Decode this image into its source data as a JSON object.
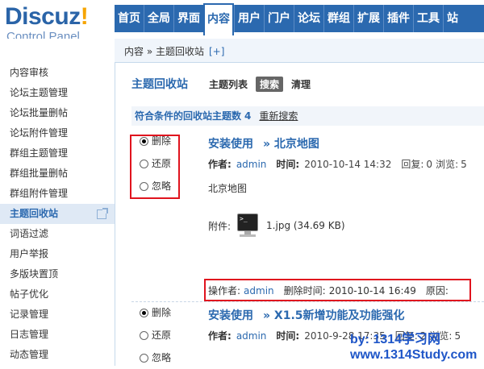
{
  "logo": {
    "word": "Discuz",
    "bang": "!",
    "subtitle": "Control Panel"
  },
  "nav": [
    "首页",
    "全局",
    "界面",
    "内容",
    "用户",
    "门户",
    "论坛",
    "群组",
    "扩展",
    "插件",
    "工具",
    "站"
  ],
  "nav_active": "内容",
  "breadcrumb": {
    "path": "内容 » 主题回收站",
    "plus": "[+]"
  },
  "sidebar": {
    "items": [
      "内容审核",
      "论坛主题管理",
      "论坛批量删帖",
      "论坛附件管理",
      "群组主题管理",
      "群组批量删帖",
      "群组附件管理",
      "主题回收站",
      "词语过滤",
      "用户举报",
      "多版块置顶",
      "帖子优化",
      "记录管理",
      "日志管理",
      "动态管理"
    ],
    "active": "主题回收站"
  },
  "main": {
    "title": "主题回收站",
    "tabs": {
      "list": "主题列表",
      "search": "搜索",
      "clear": "清理"
    },
    "count_label": "符合条件的回收站主题数",
    "count": "4",
    "reset": "重新搜索",
    "radio_labels": {
      "delete": "删除",
      "restore": "还原",
      "ignore": "忽略"
    },
    "posts": [
      {
        "title": "安装使用",
        "arrow_title": "» 北京地图",
        "author_label": "作者:",
        "author": "admin",
        "time_label": "时间:",
        "time": "2010-10-14 14:32",
        "reply_label": "回复:",
        "reply": "0",
        "view_label": "浏览:",
        "view": "5",
        "body": "北京地图",
        "attach_label": "附件:",
        "attach_file": "1.jpg (34.69 KB)",
        "op_label": "操作者:",
        "op_user": "admin",
        "del_time_label": "删除时间:",
        "del_time": "2010-10-14 16:49",
        "reason_label": "原因:"
      },
      {
        "title": "安装使用",
        "arrow_title": "» X1.5新增功能及功能强化",
        "author_label": "作者:",
        "author": "admin",
        "time_label": "时间:",
        "time": "2010-9-28 17:35",
        "reply_label": "回复:",
        "reply": "2",
        "view_label": "浏览:",
        "view": "5"
      }
    ]
  },
  "watermark": {
    "line1": "by: 1314学习网",
    "line2": "www.1314Study.com"
  },
  "colors": {
    "nav_bg": "#2b69af",
    "link": "#2b69af",
    "highlight_box": "#e0141e"
  }
}
